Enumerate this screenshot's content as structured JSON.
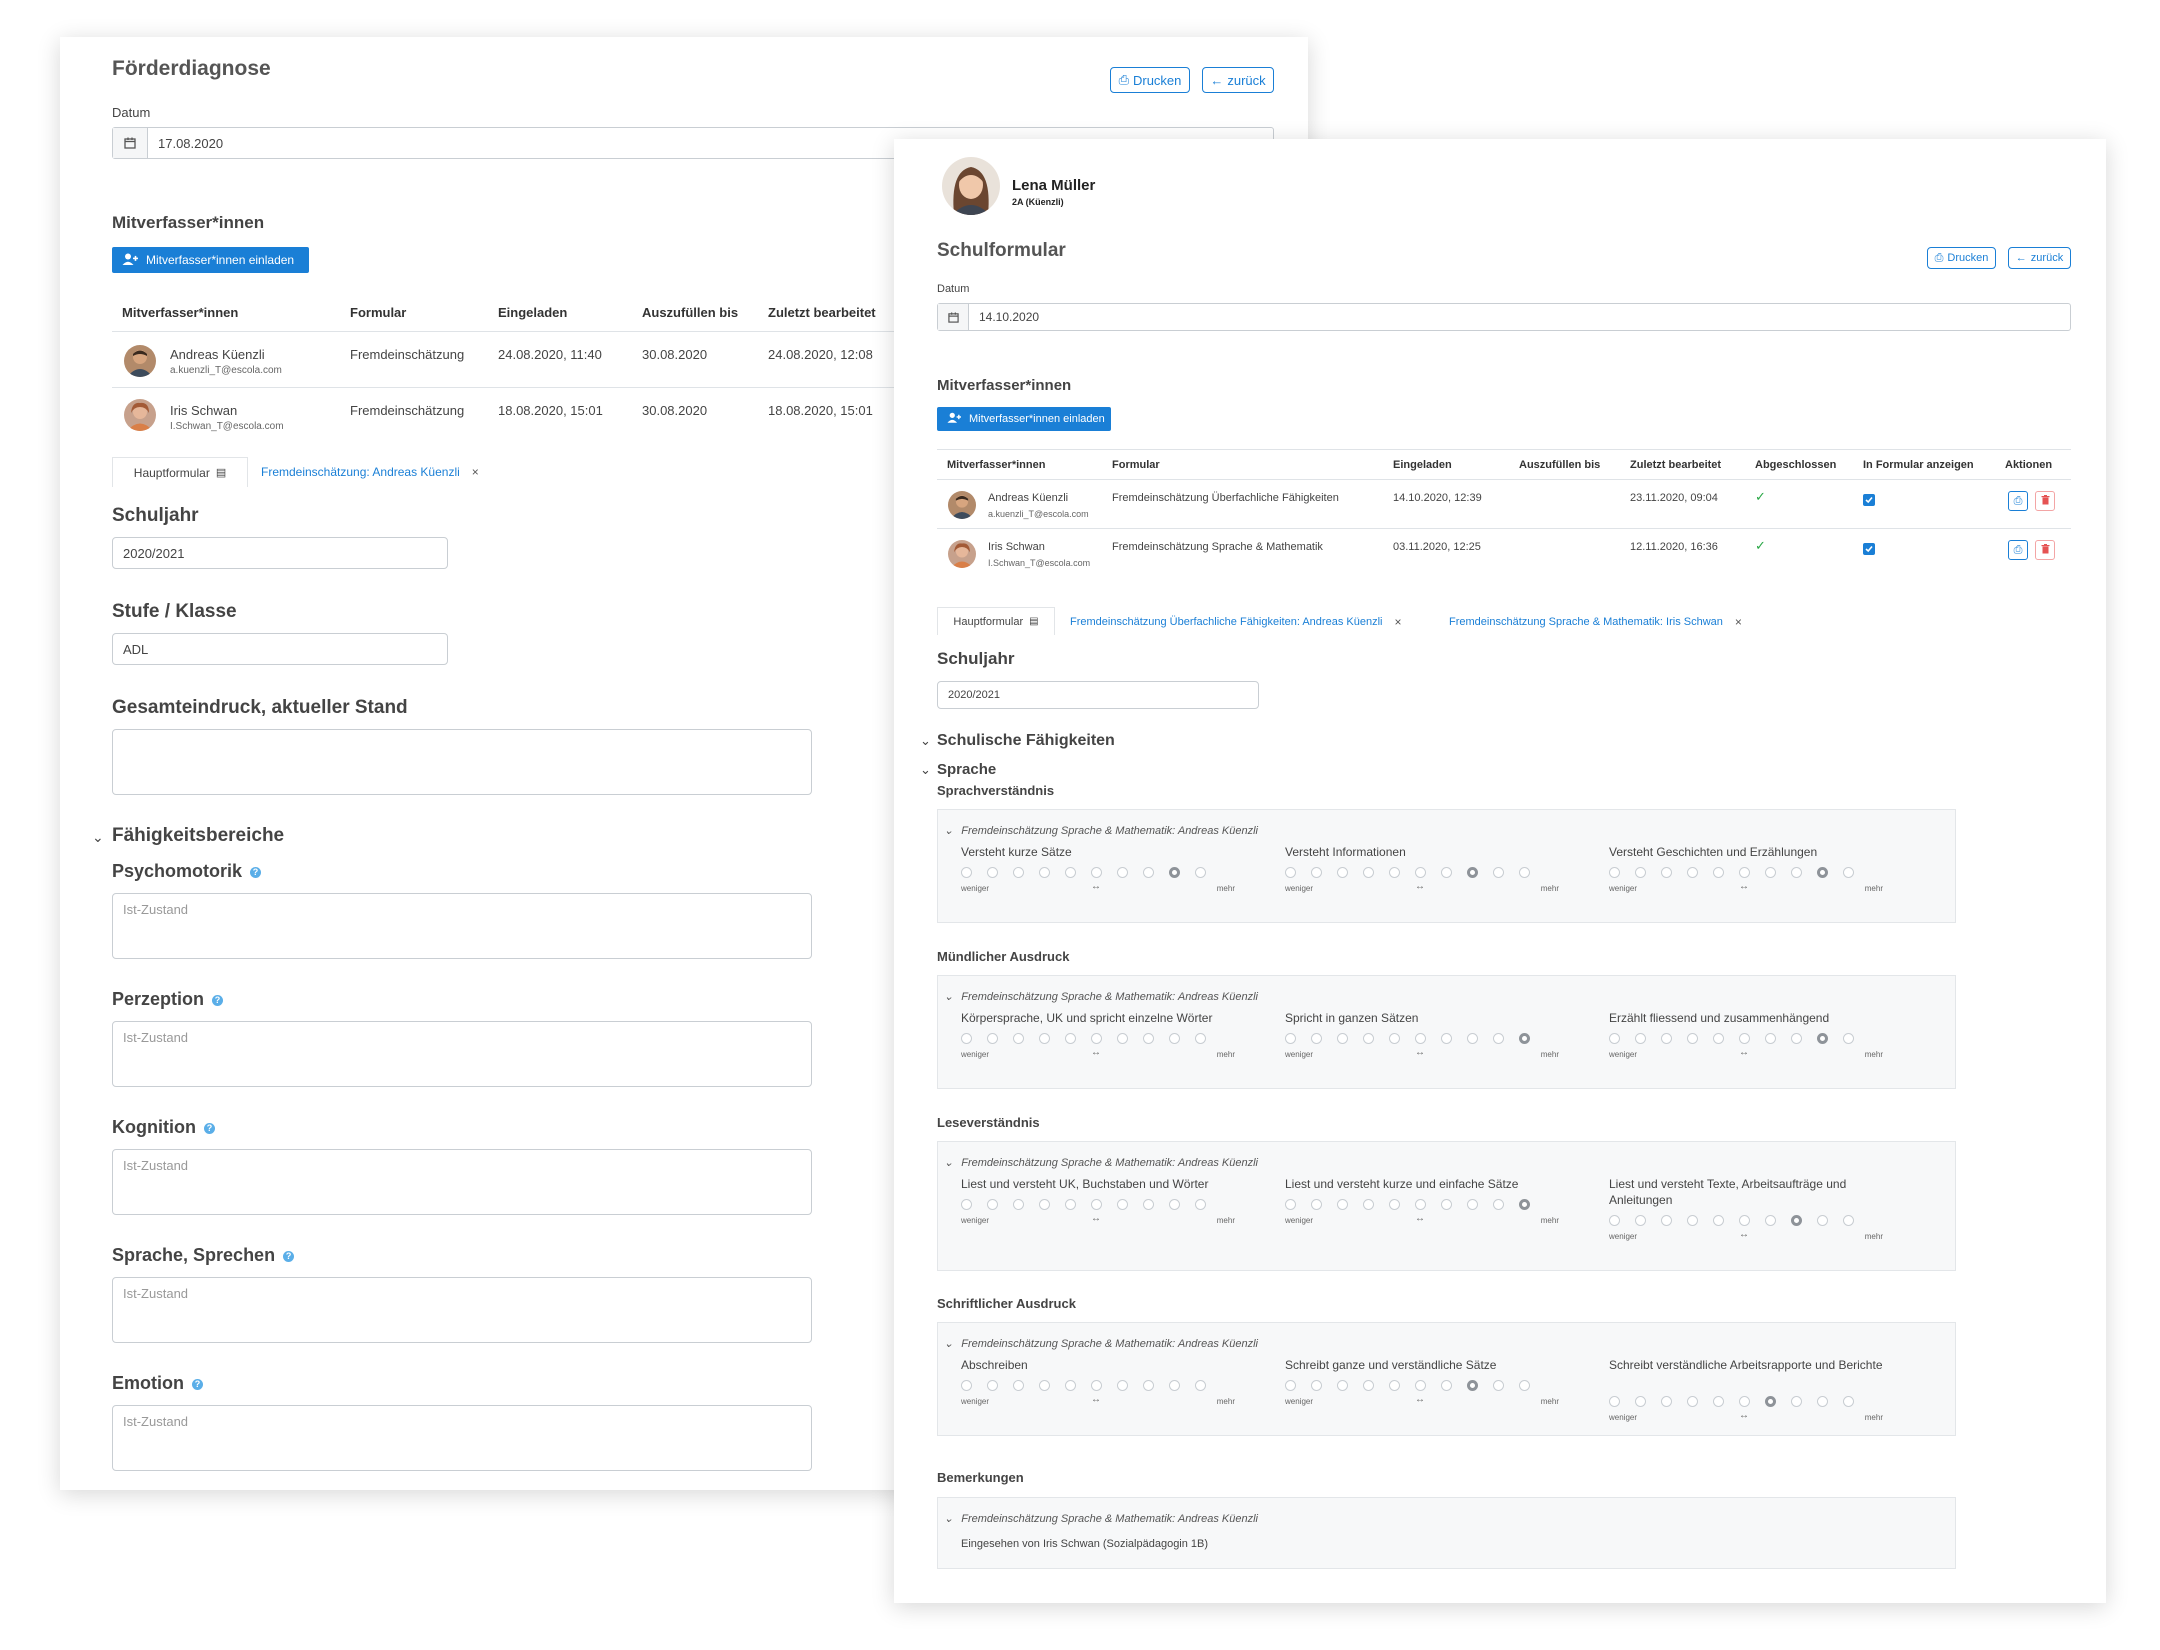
{
  "left": {
    "title": "Förderdiagnose",
    "print_label": "Drucken",
    "back_label": "zurück",
    "date_label": "Datum",
    "date_value": "17.08.2020",
    "coauthors_title": "Mitverfasser*innen",
    "invite_label": "Mitverfasser*innen einladen",
    "table_headers": [
      "Mitverfasser*innen",
      "Formular",
      "Eingeladen",
      "Auszufüllen bis",
      "Zuletzt bearbeitet"
    ],
    "rows": [
      {
        "name": "Andreas Küenzli",
        "email": "a.kuenzli_T@escola.com",
        "form": "Fremdeinschätzung",
        "invited": "24.08.2020, 11:40",
        "due": "30.08.2020",
        "edited": "24.08.2020, 12:08"
      },
      {
        "name": "Iris Schwan",
        "email": "I.Schwan_T@escola.com",
        "form": "Fremdeinschätzung",
        "invited": "18.08.2020, 15:01",
        "due": "30.08.2020",
        "edited": "18.08.2020, 15:01"
      }
    ],
    "tab_main": "Hauptformular",
    "tab_link": "Fremdeinschätzung:  Andreas Küenzli",
    "tab_close": "×",
    "schuljahr_label": "Schuljahr",
    "schuljahr_value": "2020/2021",
    "stufe_label": "Stufe / Klasse",
    "stufe_value": "ADL",
    "gesamt_label": "Gesamteindruck, aktueller Stand",
    "faehigkeit_label": "Fähigkeitsbereiche",
    "areas": [
      "Psychomotorik",
      "Perzeption",
      "Kognition",
      "Sprache, Sprechen",
      "Emotion"
    ],
    "placeholder": "Ist-Zustand",
    "help_glyph": "?"
  },
  "right": {
    "student_name": "Lena Müller",
    "student_class": "2A (Küenzli)",
    "title": "Schulformular",
    "print_label": "Drucken",
    "back_label": "zurück",
    "date_label": "Datum",
    "date_value": "14.10.2020",
    "coauthors_title": "Mitverfasser*innen",
    "invite_label": "Mitverfasser*innen einladen",
    "table_headers": [
      "Mitverfasser*innen",
      "Formular",
      "Eingeladen",
      "Auszufüllen bis",
      "Zuletzt bearbeitet",
      "Abgeschlossen",
      "In Formular anzeigen",
      "Aktionen"
    ],
    "rows": [
      {
        "name": "Andreas Küenzli",
        "email": "a.kuenzli_T@escola.com",
        "form": "Fremdeinschätzung Überfachliche Fähigkeiten",
        "invited": "14.10.2020, 12:39",
        "due": "",
        "edited": "23.11.2020, 09:04",
        "completed": true,
        "show": true
      },
      {
        "name": "Iris Schwan",
        "email": "I.Schwan_T@escola.com",
        "form": "Fremdeinschätzung Sprache & Mathematik",
        "invited": "03.11.2020, 12:25",
        "due": "",
        "edited": "12.11.2020, 16:36",
        "completed": true,
        "show": true
      }
    ],
    "tab_main": "Hauptformular",
    "tab_links": [
      "Fremdeinschätzung Überfachliche Fähigkeiten:  Andreas Küenzli",
      "Fremdeinschätzung Sprache & Mathematik:  Iris Schwan"
    ],
    "tab_close": "×",
    "schuljahr_label": "Schuljahr",
    "schuljahr_value": "2020/2021",
    "section1": "Schulische Fähigkeiten",
    "section2": "Sprache",
    "scale": {
      "low": "weniger",
      "arrow": "↔",
      "high": "mehr"
    },
    "panel_source": "Fremdeinschätzung Sprache & Mathematik:  Andreas Küenzli",
    "groups": [
      {
        "title": "Sprachverständnis",
        "items": [
          {
            "label": "Versteht kurze Sätze",
            "selected": 9
          },
          {
            "label": "Versteht Informationen",
            "selected": 8
          },
          {
            "label": "Versteht Geschichten und Erzählungen",
            "selected": 9
          }
        ]
      },
      {
        "title": "Mündlicher Ausdruck",
        "items": [
          {
            "label": "Körpersprache, UK und spricht einzelne Wörter",
            "selected": 0
          },
          {
            "label": "Spricht in ganzen Sätzen",
            "selected": 10
          },
          {
            "label": "Erzählt fliessend und zusammenhängend",
            "selected": 9
          }
        ]
      },
      {
        "title": "Leseverständnis",
        "items": [
          {
            "label": "Liest und versteht UK, Buchstaben und Wörter",
            "selected": 0
          },
          {
            "label": "Liest und versteht kurze und einfache Sätze",
            "selected": 10
          },
          {
            "label": "Liest und versteht Texte, Arbeitsaufträge und Anleitungen",
            "selected": 8
          }
        ]
      },
      {
        "title": "Schriftlicher Ausdruck",
        "items": [
          {
            "label": "Abschreiben",
            "selected": 0
          },
          {
            "label": "Schreibt ganze und verständliche Sätze",
            "selected": 8
          },
          {
            "label": "Schreibt verständliche Arbeitsrapporte und Berichte",
            "selected": 7
          }
        ]
      }
    ],
    "remarks_title": "Bemerkungen",
    "remarks_text": "Eingesehen von  Iris Schwan  (Sozialpädagogin 1B)"
  }
}
